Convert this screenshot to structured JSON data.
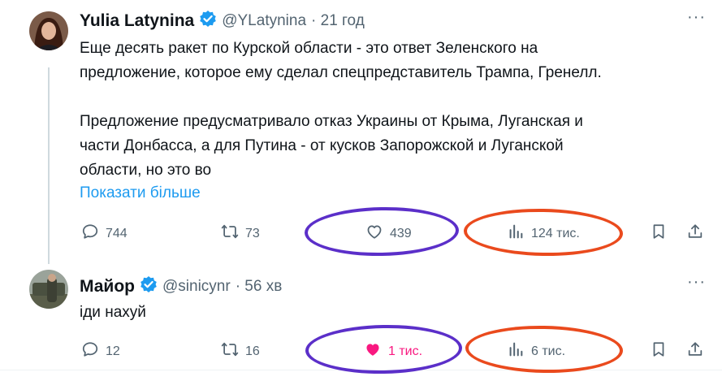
{
  "tweets": [
    {
      "author": "Yulia Latynina",
      "handle": "@YLatynina",
      "time": "· 21 год",
      "lines": [
        "Еще десять ракет по Курской области - это ответ Зеленского на",
        "предложение, которое ему сделал спецпредставитель Трампа, Гренелл.",
        "",
        "Предложение предусматривало отказ Украины от Крыма, Луганская и",
        "части Донбасса, а для Путина - от кусков Запорожской и Луганской",
        "области, но это во"
      ],
      "show_more": "Показати більше",
      "replies": "744",
      "reposts": "73",
      "likes": "439",
      "views": "124 тис.",
      "liked": false
    },
    {
      "author": "Майор",
      "handle": "@sinicynr",
      "time": "· 56 хв",
      "lines": [
        "іди нахуй"
      ],
      "replies": "12",
      "reposts": "16",
      "likes": "1 тис.",
      "views": "6 тис.",
      "liked": true
    }
  ],
  "colors": {
    "verified": "#1d9bf0",
    "like_active": "#f91880",
    "annotation_purple": "#5b2fc9",
    "annotation_red": "#ea4a1d",
    "muted": "#536471"
  }
}
